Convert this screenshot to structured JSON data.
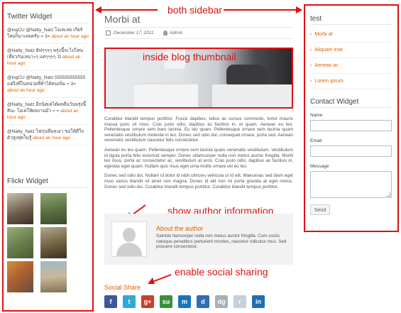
{
  "annotations": {
    "both_sidebar": "both sidebar",
    "inside_blog_thumbnail": "inside blog thumbnail",
    "show_author_information": "show author information",
    "enable_social_sharing": "enable social sharing"
  },
  "left_sidebar": {
    "twitter_title": "Twitter Widget",
    "tweets": [
      {
        "text": "@ingCU @Natty_Natz โอเคเลย เกียร์ใหม่ก็มาเลยครับ = 3=",
        "time": "about an hour ago"
      },
      {
        "text": "@Natty_Natz ฮัฟๆๆๆๆ พรุ่งนี้จะไปไหนเที่ยวกันเหมาะๆ แต่ๆๆๆๆ :D",
        "time": "about an hour ago"
      },
      {
        "text": "@ingCU @Natty_Natz 555555555555 แต่งีงพี่ในหน่วยที่ทำได้คนเพิ่ม = 3=",
        "time": "about an hour ago"
      },
      {
        "text": "@Natty_Natz อีกนิดเค่ได้ผลคืนวันพรุ่งนี้สินะ โอเคให้ผลงานมั่ว = =",
        "time": "about an hour ago"
      },
      {
        "text": "@Natty_Natz ไฟกุ่นที่ฉลเอา ขอให้ดีใจตัวสูงสุดในรู้",
        "time": "about an hour ago"
      }
    ],
    "flickr_title": "Flickr Widget"
  },
  "post": {
    "title": "Morbi at",
    "date": "December 17, 2011",
    "author": "Admin",
    "paragraphs": [
      "Curabitur blandit tempus porttitor. Fusce dapibus, tellus ac cursus commodo, tortor mauris massa justo sit risus. Cras justo odio, dapibus ac facilisis in, et quam. Aenean eu leo. Pellentesque ornare sem baro lacinia. Eu leo quam. Pellentesque ornare sem lacinia quam venenatis vestibulum molestie in leo. Donec sed odio dui, consequat ornare, porta sed. Aenean venenatis vestibulum nascetur felis consectetur.",
      "Aenean eu leo quam. Pellentesque ornare sem lacinia quam venenatis vestibulum. Vestibulum id ligula porta felis euismod semper. Donec ullamcorper nulla non metus auctor fringilla. Morbi leo risus, porta ac consectetur ac, vestibulum at eros. Cras justo odio, dapibus ac facilisis in, egestas eget quam. Nullam quis risus eget urna mollis ornare vel eu leo.",
      "Donec sed odio dui. Nullam id dolor id nibh ultricies vehicula ut id elit. Maecenas sed diam eget risus varius blandit sit amet non magna. Donec id elit non mi porta gravida at eget metus. Donec sed odio dui. Curabitur blandit tempus porttitor. Curabitur blandit tempus porttitor."
    ],
    "about_title": "About the author",
    "about_text": "Saintdo llamcorper nulla non metus auctor fringilla. Cum sociis natoque penatibus parturient montes, nascetur ridiculus mus. Sed posuere consectetur.",
    "social_title": "Social Share",
    "social_icons": [
      {
        "name": "facebook",
        "glyph": "f",
        "color": "#3b5998"
      },
      {
        "name": "twitter",
        "glyph": "t",
        "color": "#2fa8d8"
      },
      {
        "name": "google",
        "glyph": "g+",
        "color": "#c8402f"
      },
      {
        "name": "stumbleupon",
        "glyph": "su",
        "color": "#3a8f3a"
      },
      {
        "name": "myspace",
        "glyph": "m",
        "color": "#1c74b8"
      },
      {
        "name": "delicious",
        "glyph": "d",
        "color": "#2d6fb0"
      },
      {
        "name": "digg",
        "glyph": "dg",
        "color": "#a8b0b8"
      },
      {
        "name": "reddit",
        "glyph": "r",
        "color": "#c4d1de"
      },
      {
        "name": "linkedin",
        "glyph": "in",
        "color": "#1f70b0"
      }
    ]
  },
  "right_sidebar": {
    "test_title": "test",
    "links": [
      "Morbi at",
      "Aliquam erat",
      "Aenean ac",
      "Lorem ipsum"
    ],
    "contact_title": "Contact Widget",
    "name_label": "Name",
    "email_label": "Email",
    "message_label": "Message",
    "send_label": "Send"
  }
}
